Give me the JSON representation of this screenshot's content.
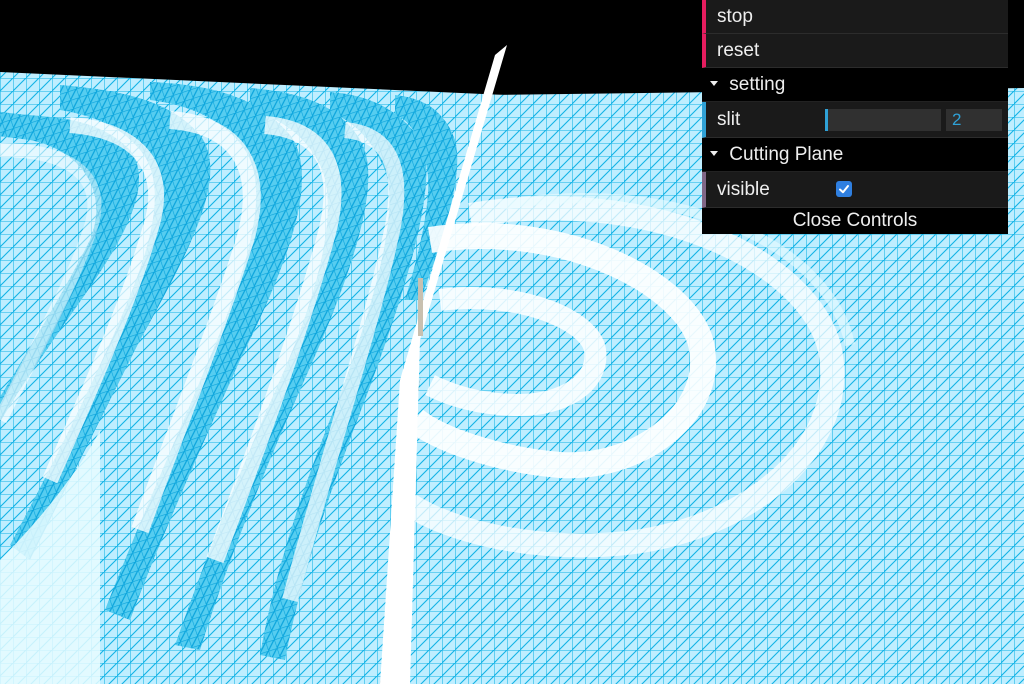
{
  "gui": {
    "stop_label": "stop",
    "reset_label": "reset",
    "setting_folder_label": "setting",
    "slit_label": "slit",
    "slit_value": "2",
    "slit_fill_fraction": 0.02,
    "cutting_plane_folder_label": "Cutting Plane",
    "visible_label": "visible",
    "visible_checked": true,
    "close_label": "Close Controls"
  },
  "colors": {
    "background": "#000000",
    "mesh": "#0fb6e6",
    "mesh_light": "#d9f6ff",
    "function_accent": "#e61d5f",
    "number_accent": "#2fa1d6",
    "boolean_accent": "#806787",
    "checkbox": "#2f7fe0"
  }
}
